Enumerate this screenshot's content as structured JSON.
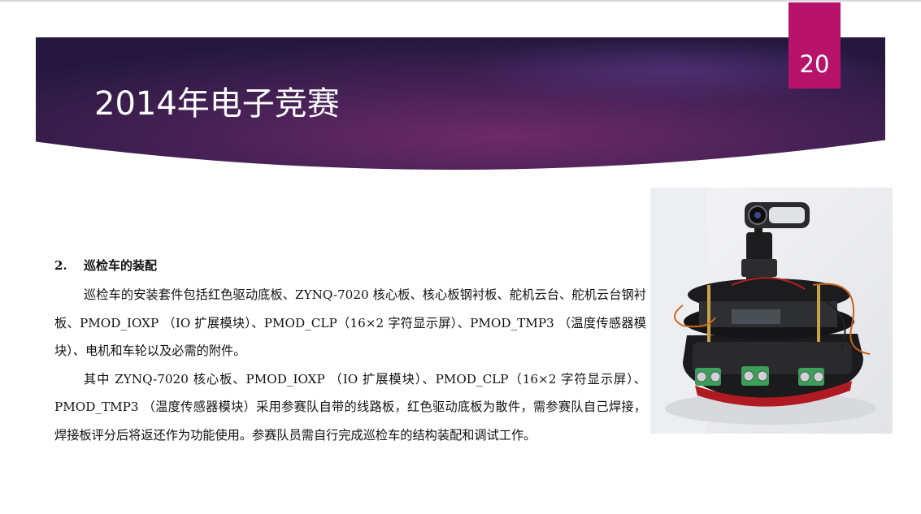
{
  "slide": {
    "title": "2014年电子竞赛",
    "page_number": "20"
  },
  "content": {
    "heading_number": "2.",
    "heading_text": "巡检车的装配",
    "paragraph_1": "巡检车的安装套件包括红色驱动底板、ZYNQ-7020 核心板、核心板钢衬板、舵机云台、舵机云台钢衬板、PMOD_IOXP （IO 扩展模块）、PMOD_CLP（16×2 字符显示屏）、PMOD_TMP3 （温度传感器模块）、电机和车轮以及必需的附件。",
    "paragraph_2": "其中 ZYNQ-7020 核心板、PMOD_IOXP （IO 扩展模块）、PMOD_CLP（16×2 字符显示屏）、PMOD_TMP3 （温度传感器模块）采用参赛队自带的线路板，红色驱动底板为散件，需参赛队自己焊接，焊接板评分后将返还作为功能使用。参赛队员需自行完成巡检车的结构装配和调试工作。"
  },
  "colors": {
    "banner_dark": "#2a1a4a",
    "banner_mid": "#6a2a6a",
    "badge": "#b8136b"
  },
  "image": {
    "subject": "assembled patrol robot car with camera"
  }
}
